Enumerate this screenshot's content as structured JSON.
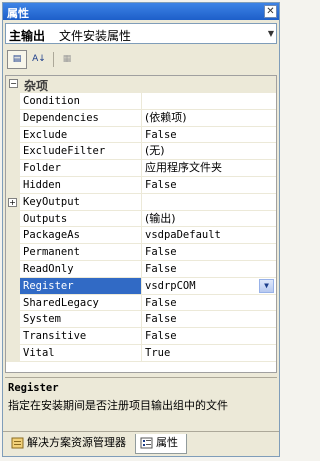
{
  "window": {
    "title": "属性"
  },
  "object_selector": {
    "name": "主输出",
    "type": "文件安装属性"
  },
  "toolbar": {
    "categorized_glyph": "▤",
    "alpha_glyph": "A↓",
    "pages_glyph": "▦"
  },
  "category": {
    "toggle": "−",
    "label": "杂项"
  },
  "properties": [
    {
      "name": "Condition",
      "value": ""
    },
    {
      "name": "Dependencies",
      "value": "(依赖项)"
    },
    {
      "name": "Exclude",
      "value": "False"
    },
    {
      "name": "ExcludeFilter",
      "value": "(无)"
    },
    {
      "name": "Folder",
      "value": "应用程序文件夹"
    },
    {
      "name": "Hidden",
      "value": "False"
    },
    {
      "name": "KeyOutput",
      "value": ""
    },
    {
      "name": "Outputs",
      "value": "(输出)"
    },
    {
      "name": "PackageAs",
      "value": "vsdpaDefault"
    },
    {
      "name": "Permanent",
      "value": "False"
    },
    {
      "name": "ReadOnly",
      "value": "False"
    },
    {
      "name": "Register",
      "value": "vsdrpCOM"
    },
    {
      "name": "SharedLegacy",
      "value": "False"
    },
    {
      "name": "System",
      "value": "False"
    },
    {
      "name": "Transitive",
      "value": "False"
    },
    {
      "name": "Vital",
      "value": "True"
    }
  ],
  "expand_marker": "+",
  "description": {
    "title": "Register",
    "text": "指定在安装期间是否注册项目输出组中的文件"
  },
  "tabs": [
    {
      "label": "解决方案资源管理器"
    },
    {
      "label": "属性"
    }
  ],
  "colors": {
    "selection": "#316ac5",
    "titlebar": "#1d5fc9",
    "chrome": "#ece9d8"
  }
}
